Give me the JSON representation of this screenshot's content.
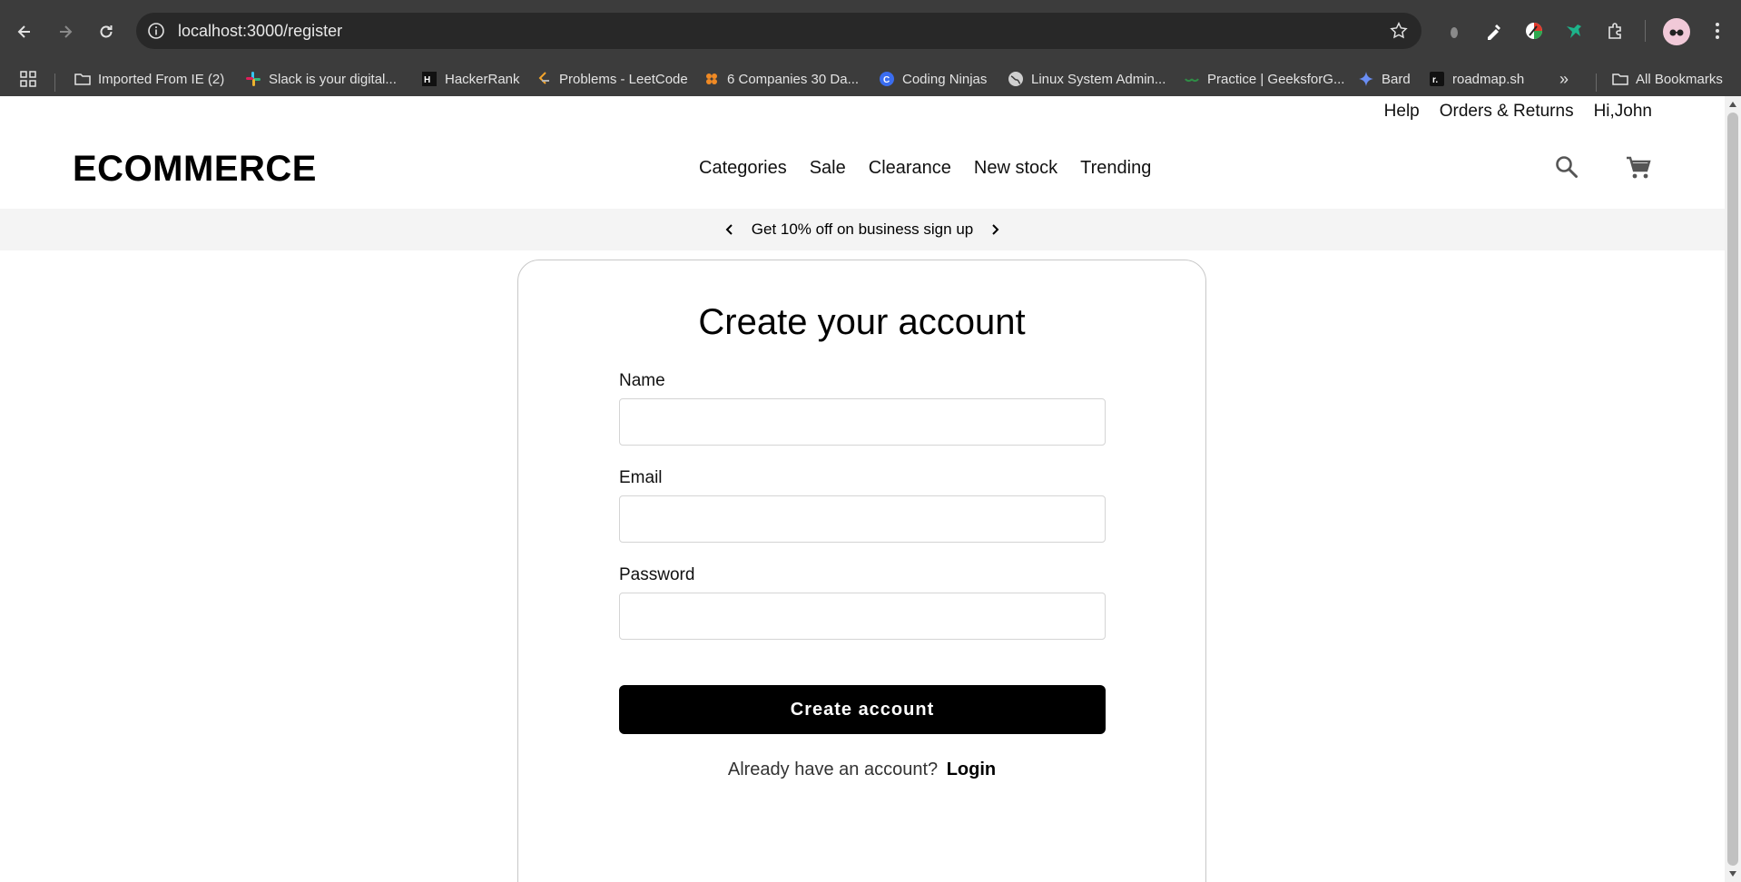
{
  "browser": {
    "url": "localhost:3000/register",
    "bookmarks": [
      {
        "label": "Imported From IE (2)",
        "icon": "folder-icon"
      },
      {
        "label": "Slack is your digital...",
        "icon": "slack-icon"
      },
      {
        "label": "HackerRank",
        "icon": "hackerrank-icon"
      },
      {
        "label": "Problems - LeetCode",
        "icon": "leetcode-icon"
      },
      {
        "label": "6 Companies 30 Da...",
        "icon": "companies-icon"
      },
      {
        "label": "Coding Ninjas",
        "icon": "codingninjas-icon"
      },
      {
        "label": "Linux System Admin...",
        "icon": "globe-icon"
      },
      {
        "label": "Practice | GeeksforG...",
        "icon": "geeksforgeeks-icon"
      },
      {
        "label": "Bard",
        "icon": "bard-icon"
      },
      {
        "label": "roadmap.sh",
        "icon": "roadmap-icon"
      }
    ],
    "more_bookmarks": "»",
    "all_bookmarks": "All Bookmarks"
  },
  "header": {
    "top_links": [
      "Help",
      "Orders & Returns",
      "Hi,John"
    ],
    "brand": "ECOMMERCE",
    "nav": [
      "Categories",
      "Sale",
      "Clearance",
      "New stock",
      "Trending"
    ]
  },
  "promo": {
    "text": "Get 10% off on business sign up"
  },
  "form": {
    "title": "Create your account",
    "name_label": "Name",
    "name_value": "",
    "email_label": "Email",
    "email_value": "",
    "password_label": "Password",
    "password_value": "",
    "submit_label": "Create account",
    "login_prompt": "Already have an account?",
    "login_link": "Login"
  },
  "colors": {
    "chrome_bg": "#3c3c3c",
    "omnibox_bg": "#282828",
    "promo_bg": "#f4f4f4",
    "button_bg": "#000000"
  }
}
